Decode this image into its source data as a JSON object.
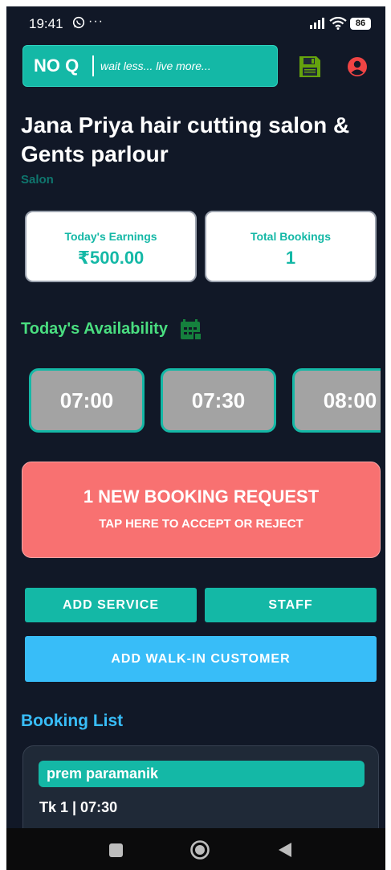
{
  "status_bar": {
    "time": "19:41",
    "battery": "86",
    "icons": [
      "whatsapp-icon",
      "more-icon",
      "signal-icon",
      "wifi-icon",
      "battery-icon"
    ]
  },
  "header": {
    "brand": "NO Q",
    "tagline": "wait less... live more...",
    "icons": [
      "save-icon",
      "profile-icon"
    ],
    "colors": {
      "brand_bg": "#14b8a6",
      "save": "#65a30d",
      "profile": "#ef4444"
    }
  },
  "shop": {
    "name": "Jana Priya hair cutting salon & Gents parlour",
    "category": "Salon"
  },
  "stats": {
    "earnings_label": "Today's Earnings",
    "earnings_value": "₹500.00",
    "bookings_label": "Total Bookings",
    "bookings_value": "1"
  },
  "availability": {
    "title": "Today's Availability",
    "icon": "calendar-icon",
    "slots": [
      "07:00",
      "07:30",
      "08:00"
    ]
  },
  "request_banner": {
    "title": "1 NEW BOOKING REQUEST",
    "subtitle": "TAP HERE TO ACCEPT OR REJECT",
    "color": "#f87171"
  },
  "actions": {
    "add_service": "ADD SERVICE",
    "staff": "STAFF",
    "add_walkin": "ADD WALK-IN CUSTOMER"
  },
  "booking_list": {
    "title": "Booking List",
    "items": [
      {
        "name": "prem paramanik",
        "token": "Tk 1 | 07:30"
      }
    ]
  },
  "nav_bar": {
    "icons": [
      "recents-icon",
      "home-icon",
      "back-icon"
    ]
  }
}
